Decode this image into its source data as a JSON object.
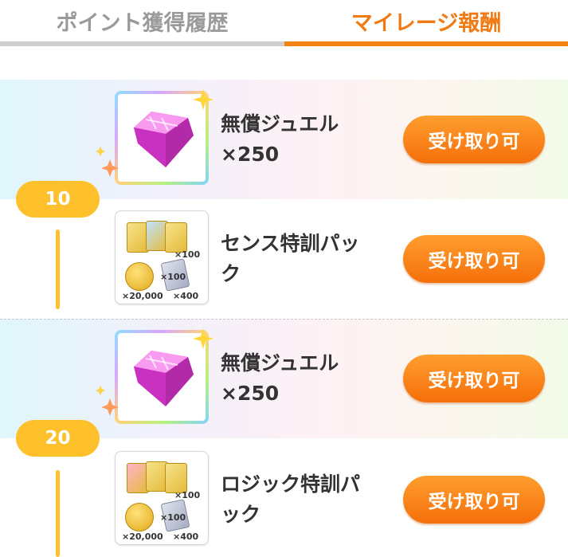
{
  "tabs": [
    {
      "label": "ポイント獲得履歴",
      "active": false
    },
    {
      "label": "マイレージ報酬",
      "active": true
    }
  ],
  "colors": {
    "accent": "#f58314",
    "inactive_tab_text": "#9a9a9a",
    "timeline": "#ffc12b",
    "button_top": "#ff9e2e",
    "button_bottom": "#f56f0b"
  },
  "milestones": [
    {
      "level": "10",
      "rewards": [
        {
          "icon": "jewel-icon",
          "name_line1": "無償ジュエル",
          "name_line2": "×250",
          "button": "受け取り可"
        },
        {
          "icon": "sense-training-pack-icon",
          "name_line1": "センス特訓パッ",
          "name_line2": "ク",
          "button": "受け取り可",
          "pack_counts": {
            "tickets": "×100",
            "coins": "×20,000",
            "papers_top": "×100",
            "papers_bottom": "×400"
          }
        }
      ]
    },
    {
      "level": "20",
      "rewards": [
        {
          "icon": "jewel-icon",
          "name_line1": "無償ジュエル",
          "name_line2": "×250",
          "button": "受け取り可"
        },
        {
          "icon": "logic-training-pack-icon",
          "name_line1": "ロジック特訓パ",
          "name_line2": "ック",
          "button": "受け取り可",
          "pack_counts": {
            "tickets": "×100",
            "coins": "×20,000",
            "papers_top": "×100",
            "papers_bottom": "×400"
          }
        }
      ]
    }
  ]
}
